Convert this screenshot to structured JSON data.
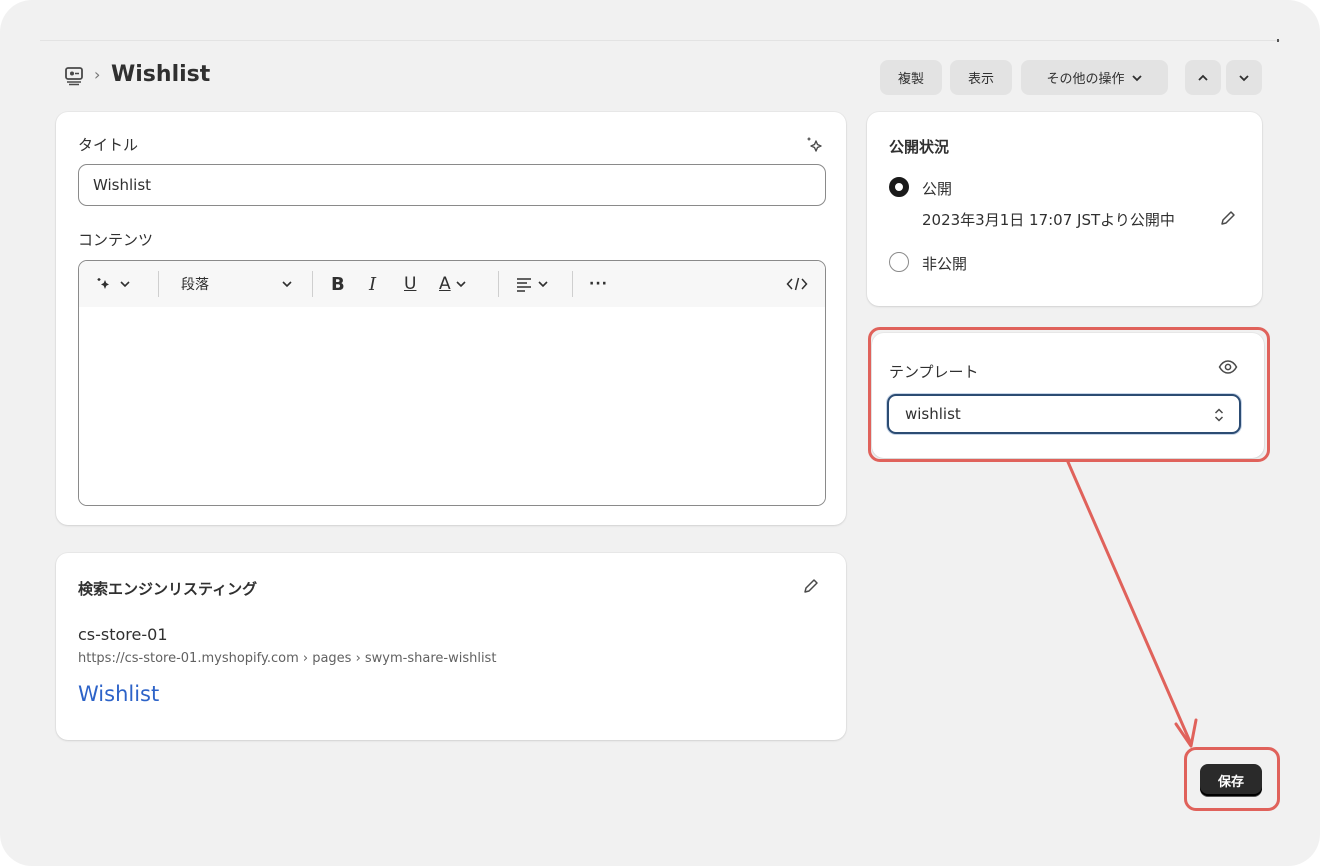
{
  "header": {
    "breadcrumb_separator": "›",
    "title": "Wishlist",
    "buttons": {
      "duplicate": "複製",
      "view": "表示",
      "more_actions": "その他の操作"
    }
  },
  "title_card": {
    "title_label": "タイトル",
    "title_value": "Wishlist",
    "content_label": "コンテンツ",
    "toolbar": {
      "paragraph": "段落",
      "bold": "B",
      "italic": "I",
      "underline": "U",
      "text_color": "A",
      "more": "···"
    }
  },
  "seo_card": {
    "heading": "検索エンジンリスティング",
    "store_name": "cs-store-01",
    "url": "https://cs-store-01.myshopify.com › pages › swym-share-wishlist",
    "page_title": "Wishlist"
  },
  "visibility_card": {
    "heading": "公開状況",
    "options": [
      {
        "label": "公開",
        "selected": true,
        "detail": "2023年3月1日 17:07 JSTより公開中"
      },
      {
        "label": "非公開",
        "selected": false
      }
    ]
  },
  "template_card": {
    "heading": "テンプレート",
    "selected": "wishlist"
  },
  "footer": {
    "save_label": "保存"
  },
  "colors": {
    "background": "#f1f1f1",
    "card": "#ffffff",
    "annotation": "#e0625b",
    "link": "#2d63c8",
    "primary_button": "#2a2a2a"
  }
}
